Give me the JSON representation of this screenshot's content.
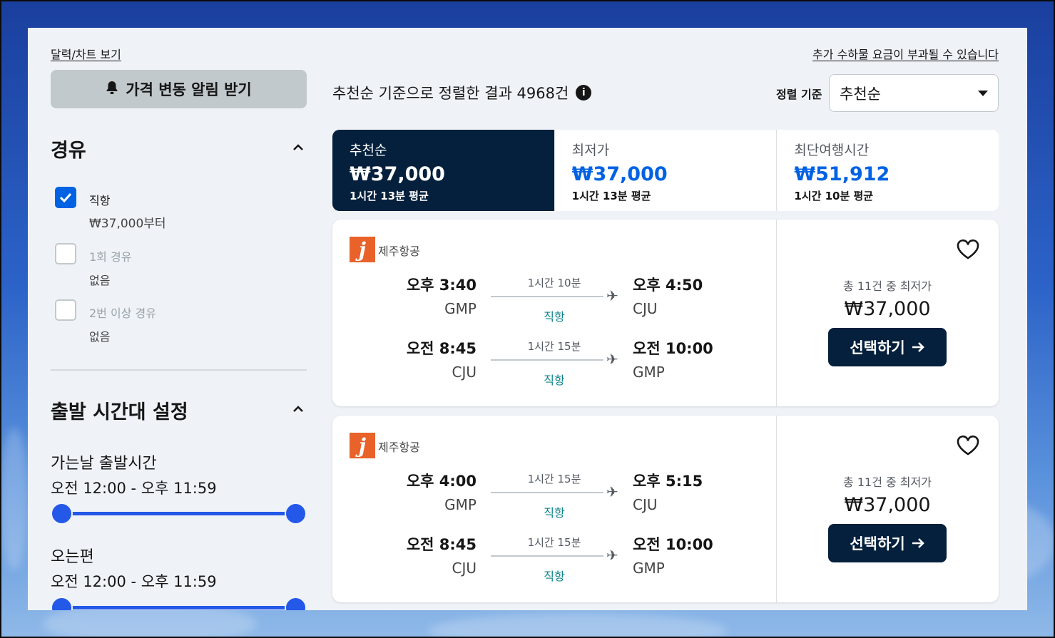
{
  "colors": {
    "accent": "#0062e3",
    "dark": "#05203c",
    "direct": "#0c838a",
    "airline": "#e8622a"
  },
  "top_links": {
    "calendar": "달력/차트 보기",
    "surcharge": "추가 수하물 요금이 부과될 수 있습니다"
  },
  "alert_button": {
    "label": "가격 변동 알림 받기",
    "icon": "bell-icon"
  },
  "stops": {
    "title": "경유",
    "options": [
      {
        "label": "직항",
        "sub": "₩37,000부터",
        "checked": true,
        "enabled": true
      },
      {
        "label": "1회 경유",
        "sub": "없음",
        "checked": false,
        "enabled": false
      },
      {
        "label": "2번 이상 경유",
        "sub": "없음",
        "checked": false,
        "enabled": false
      }
    ]
  },
  "departure_times": {
    "title": "출발 시간대 설정",
    "outbound": {
      "label": "가는날 출발시간",
      "range": "오전 12:00 - 오후 11:59"
    },
    "return": {
      "label": "오는편",
      "range": "오전 12:00 - 오후 11:59"
    }
  },
  "results": {
    "summary": "추천순 기준으로 정렬한 결과 4968건"
  },
  "sort": {
    "label": "정렬 기준",
    "selected": "추천순"
  },
  "tabs": [
    {
      "label": "추천순",
      "price": "₩37,000",
      "sub": "1시간 13분 평균",
      "active": true
    },
    {
      "label": "최저가",
      "price": "₩37,000",
      "sub": "1시간 13분 평균",
      "active": false
    },
    {
      "label": "최단여행시간",
      "price": "₩51,912",
      "sub": "1시간 10분 평균",
      "active": false
    }
  ],
  "cards": [
    {
      "airline": "제주항공",
      "legs": [
        {
          "dep_time": "오후 3:40",
          "dep_code": "GMP",
          "duration": "1시간 10분",
          "stops": "직항",
          "arr_time": "오후 4:50",
          "arr_code": "CJU"
        },
        {
          "dep_time": "오전 8:45",
          "dep_code": "CJU",
          "duration": "1시간 15분",
          "stops": "직항",
          "arr_time": "오전 10:00",
          "arr_code": "GMP"
        }
      ],
      "price_note": "총 11건 중 최저가",
      "price": "₩37,000",
      "button": "선택하기"
    },
    {
      "airline": "제주항공",
      "legs": [
        {
          "dep_time": "오후 4:00",
          "dep_code": "GMP",
          "duration": "1시간 15분",
          "stops": "직항",
          "arr_time": "오후 5:15",
          "arr_code": "CJU"
        },
        {
          "dep_time": "오전 8:45",
          "dep_code": "CJU",
          "duration": "1시간 15분",
          "stops": "직항",
          "arr_time": "오전 10:00",
          "arr_code": "GMP"
        }
      ],
      "price_note": "총 11건 중 최저가",
      "price": "₩37,000",
      "button": "선택하기"
    }
  ]
}
